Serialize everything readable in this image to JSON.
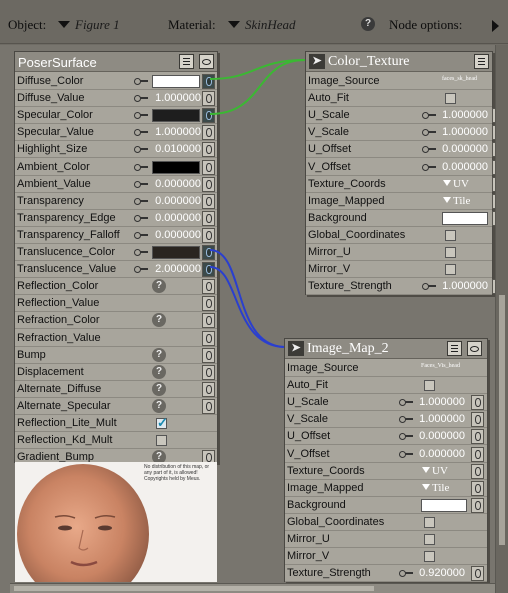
{
  "topbar": {
    "object_label": "Object:",
    "object_value": "Figure 1",
    "material_label": "Material:",
    "material_value": "SkinHead",
    "help_glyph": "?",
    "node_options_label": "Node options:"
  },
  "poser_surface": {
    "title": "PoserSurface",
    "rows": [
      {
        "label": "Diffuse_Color",
        "kind": "color",
        "color": "#ffffff",
        "linked": true
      },
      {
        "label": "Diffuse_Value",
        "kind": "value",
        "value": "1.000000"
      },
      {
        "label": "Specular_Color",
        "kind": "color",
        "color": "#1e1e1e",
        "linked": true
      },
      {
        "label": "Specular_Value",
        "kind": "value",
        "value": "1.000000"
      },
      {
        "label": "Highlight_Size",
        "kind": "value",
        "value": "0.010000"
      },
      {
        "label": "Ambient_Color",
        "kind": "color",
        "color": "#000000"
      },
      {
        "label": "Ambient_Value",
        "kind": "value",
        "value": "0.000000"
      },
      {
        "label": "Transparency",
        "kind": "value",
        "value": "0.000000"
      },
      {
        "label": "Transparency_Edge",
        "kind": "value",
        "value": "0.000000"
      },
      {
        "label": "Transparency_Falloff",
        "kind": "value",
        "value": "0.000000"
      },
      {
        "label": "Translucence_Color",
        "kind": "color",
        "color": "#2a2520",
        "linked": true
      },
      {
        "label": "Translucence_Value",
        "kind": "value",
        "value": "2.000000",
        "linked": true
      },
      {
        "label": "Reflection_Color",
        "kind": "help"
      },
      {
        "label": "Reflection_Value",
        "kind": "plain"
      },
      {
        "label": "Refraction_Color",
        "kind": "help"
      },
      {
        "label": "Refraction_Value",
        "kind": "plain"
      },
      {
        "label": "Bump",
        "kind": "help"
      },
      {
        "label": "Displacement",
        "kind": "help"
      },
      {
        "label": "Alternate_Diffuse",
        "kind": "help"
      },
      {
        "label": "Alternate_Specular",
        "kind": "help"
      },
      {
        "label": "Reflection_Lite_Mult",
        "kind": "check",
        "checked": true
      },
      {
        "label": "Reflection_Kd_Mult",
        "kind": "check",
        "checked": false
      },
      {
        "label": "Gradient_Bump",
        "kind": "help"
      }
    ],
    "preview_note": "No distribution of this map, or any part of it, is allowed! Copyrights held by Meus."
  },
  "color_texture": {
    "title": "Color_Texture",
    "rows": [
      {
        "label": "Image_Source",
        "kind": "file",
        "value": "faces_sk_head"
      },
      {
        "label": "Auto_Fit",
        "kind": "check",
        "checked": false
      },
      {
        "label": "U_Scale",
        "kind": "value",
        "value": "1.000000"
      },
      {
        "label": "V_Scale",
        "kind": "value",
        "value": "1.000000"
      },
      {
        "label": "U_Offset",
        "kind": "value",
        "value": "0.000000"
      },
      {
        "label": "V_Offset",
        "kind": "value",
        "value": "0.000000"
      },
      {
        "label": "Texture_Coords",
        "kind": "drop",
        "value": "UV"
      },
      {
        "label": "Image_Mapped",
        "kind": "drop",
        "value": "Tile"
      },
      {
        "label": "Background",
        "kind": "color",
        "color": "#ffffff"
      },
      {
        "label": "Global_Coordinates",
        "kind": "check",
        "checked": false
      },
      {
        "label": "Mirror_U",
        "kind": "check",
        "checked": false
      },
      {
        "label": "Mirror_V",
        "kind": "check",
        "checked": false
      },
      {
        "label": "Texture_Strength",
        "kind": "value",
        "value": "1.000000"
      }
    ]
  },
  "image_map_2": {
    "title": "Image_Map_2",
    "rows": [
      {
        "label": "Image_Source",
        "kind": "file",
        "value": "Faces_Vis_head"
      },
      {
        "label": "Auto_Fit",
        "kind": "check",
        "checked": false
      },
      {
        "label": "U_Scale",
        "kind": "value",
        "value": "1.000000"
      },
      {
        "label": "V_Scale",
        "kind": "value",
        "value": "1.000000"
      },
      {
        "label": "U_Offset",
        "kind": "value",
        "value": "0.000000"
      },
      {
        "label": "V_Offset",
        "kind": "value",
        "value": "0.000000"
      },
      {
        "label": "Texture_Coords",
        "kind": "drop",
        "value": "UV"
      },
      {
        "label": "Image_Mapped",
        "kind": "drop",
        "value": "Tile"
      },
      {
        "label": "Background",
        "kind": "color",
        "color": "#ffffff"
      },
      {
        "label": "Global_Coordinates",
        "kind": "check",
        "checked": false
      },
      {
        "label": "Mirror_U",
        "kind": "check",
        "checked": false
      },
      {
        "label": "Mirror_V",
        "kind": "check",
        "checked": false
      },
      {
        "label": "Texture_Strength",
        "kind": "value",
        "value": "0.920000"
      }
    ]
  },
  "colors": {
    "wire_green": "#3bb833",
    "wire_blue": "#2a3fcf"
  }
}
